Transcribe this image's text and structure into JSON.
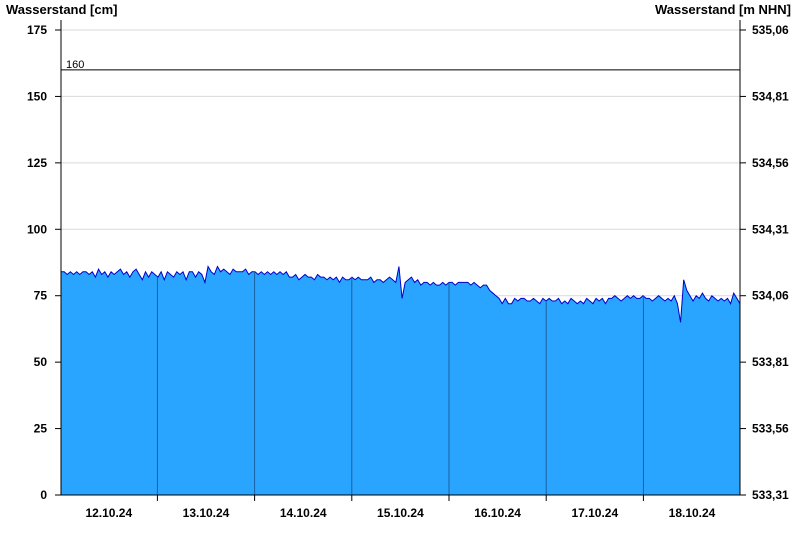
{
  "chart_data": {
    "type": "area",
    "title": "",
    "ylabel_left": "Wasserstand [cm]",
    "ylabel_right": "Wasserstand [m NHN]",
    "ylim": [
      0,
      175
    ],
    "yticks_left": [
      0,
      25,
      50,
      75,
      100,
      125,
      150,
      175
    ],
    "yticks_right": [
      "533,31",
      "533,56",
      "533,81",
      "534,06",
      "534,31",
      "534,56",
      "534,81",
      "535,06"
    ],
    "xlabels": [
      "12.10.24",
      "13.10.24",
      "14.10.24",
      "15.10.24",
      "16.10.24",
      "17.10.24",
      "18.10.24"
    ],
    "x_start": "11.10.24 12:00",
    "x_end": "18.10.24 11:00",
    "reference_line": {
      "value": 160,
      "label": "160"
    },
    "grid": true,
    "fill_color": "#2aa5ff",
    "line_color": "#0000c8",
    "series": [
      {
        "values": [
          84,
          84,
          83,
          84,
          83,
          84,
          83,
          84,
          84,
          83,
          84,
          82,
          85,
          83,
          84,
          82,
          84,
          83,
          84,
          85,
          83,
          84,
          82,
          84,
          85,
          83,
          81,
          84,
          82,
          84,
          83,
          82,
          84,
          81,
          84,
          83,
          82,
          84,
          83,
          84,
          81,
          84,
          84,
          82,
          84,
          83,
          80,
          86,
          84,
          83,
          86,
          84,
          85,
          84,
          83,
          85,
          84,
          84,
          84,
          85,
          83,
          84,
          84,
          83,
          84,
          83,
          84,
          83,
          84,
          83,
          84,
          83,
          84,
          82,
          82,
          83,
          81,
          82,
          83,
          82,
          82,
          81,
          83,
          82,
          82,
          81,
          82,
          81,
          82,
          80,
          82,
          81,
          81,
          82,
          81,
          82,
          81,
          81,
          81,
          82,
          80,
          81,
          81,
          80,
          81,
          82,
          81,
          80,
          86,
          74,
          80,
          81,
          82,
          80,
          81,
          79,
          80,
          80,
          79,
          80,
          79,
          79,
          80,
          79,
          80,
          80,
          79,
          80,
          80,
          80,
          80,
          79,
          80,
          79,
          78,
          79,
          79,
          77,
          76,
          75,
          74,
          72,
          74,
          72,
          72,
          74,
          73,
          74,
          74,
          73,
          73,
          74,
          73,
          72,
          74,
          73,
          74,
          73,
          73,
          74,
          72,
          73,
          72,
          74,
          73,
          72,
          73,
          72,
          74,
          73,
          72,
          74,
          73,
          74,
          72,
          74,
          74,
          75,
          74,
          73,
          74,
          75,
          74,
          75,
          74,
          74,
          75,
          74,
          74,
          73,
          74,
          75,
          74,
          73,
          74,
          73,
          75,
          72,
          65,
          81,
          77,
          75,
          73,
          75,
          74,
          76,
          74,
          73,
          75,
          74,
          73,
          74,
          73,
          74,
          72,
          76,
          74,
          72
        ]
      }
    ]
  }
}
